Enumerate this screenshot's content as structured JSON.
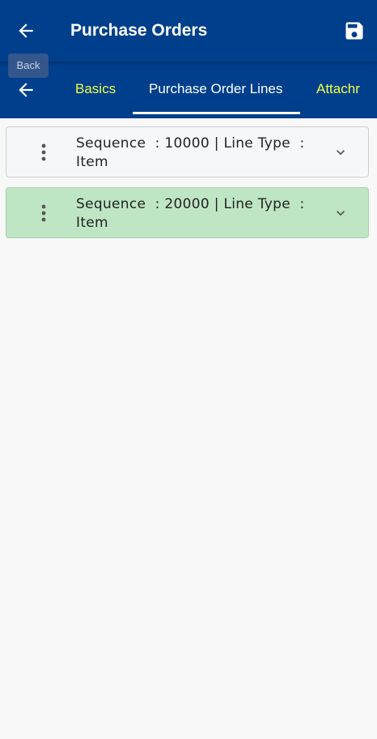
{
  "appbar": {
    "title": "Purchase Orders",
    "back_icon": "arrow-left-icon",
    "save_icon": "floppy-disk-icon"
  },
  "tooltip": {
    "text": "Back"
  },
  "tabs": {
    "back_icon": "arrow-left-icon",
    "items": [
      {
        "label": "Basics",
        "active": false
      },
      {
        "label": "Purchase Order Lines",
        "active": true
      },
      {
        "label": "Attachr",
        "active": false
      }
    ]
  },
  "lines": [
    {
      "seq_label": "Sequence",
      "seq_value": "10000",
      "type_label": "Line Type",
      "type_value": "Item",
      "selected": false
    },
    {
      "seq_label": "Sequence",
      "seq_value": "20000",
      "type_label": "Line Type",
      "type_value": "Item",
      "selected": true
    }
  ],
  "colors": {
    "primary": "#003f8c",
    "tab_inactive": "#f2ff4a",
    "selected_row": "#bfe6c4"
  }
}
